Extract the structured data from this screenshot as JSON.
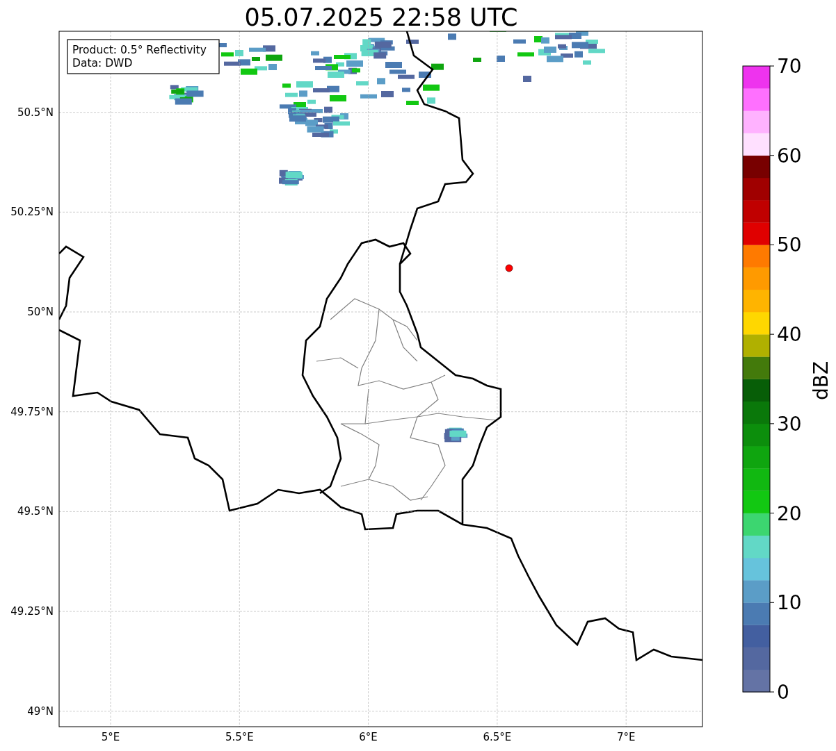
{
  "title": "05.07.2025 22:58 UTC",
  "legend": [
    "Product: 0.5° Reflectivity",
    "Data: DWD"
  ],
  "map": {
    "xticks": [
      "5°E",
      "5.5°E",
      "6°E",
      "6.5°E",
      "7°E"
    ],
    "yticks": [
      "50.5°N",
      "50.25°N",
      "50°N",
      "49.75°N",
      "49.5°N",
      "49.25°N",
      "49°N"
    ]
  },
  "colorbar": {
    "label": "dBZ",
    "ticks": [
      "70",
      "60",
      "50",
      "40",
      "30",
      "20",
      "10",
      "0"
    ],
    "bins": [
      {
        "color": "#6473a5"
      },
      {
        "color": "#5468a0"
      },
      {
        "color": "#435fa0"
      },
      {
        "color": "#4b7bb2"
      },
      {
        "color": "#5b9dc7"
      },
      {
        "color": "#66c3dc"
      },
      {
        "color": "#62d8c6"
      },
      {
        "color": "#3cd670"
      },
      {
        "color": "#12c812"
      },
      {
        "color": "#11b811"
      },
      {
        "color": "#0fa50f"
      },
      {
        "color": "#0c8e0c"
      },
      {
        "color": "#0a780a"
      },
      {
        "color": "#075e07"
      },
      {
        "color": "#437a0b"
      },
      {
        "color": "#b0b000"
      },
      {
        "color": "#ffd700"
      },
      {
        "color": "#ffb400"
      },
      {
        "color": "#ff9a00"
      },
      {
        "color": "#ff7a00"
      },
      {
        "color": "#e00000"
      },
      {
        "color": "#c00000"
      },
      {
        "color": "#a00000"
      },
      {
        "color": "#780000"
      },
      {
        "color": "#ffe0ff"
      },
      {
        "color": "#ffb2ff"
      },
      {
        "color": "#ff70ff"
      },
      {
        "color": "#ee33ee"
      }
    ]
  }
}
